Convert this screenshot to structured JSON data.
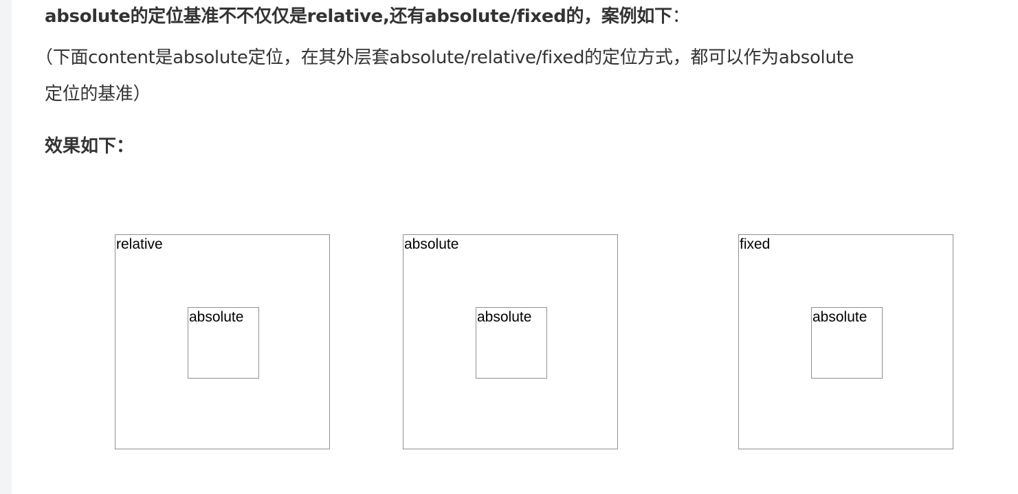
{
  "article": {
    "heading": "absolute的定位基准不不仅仅是relative,还有absolute/fixed的，案例如下",
    "heading_colon": "：",
    "paragraph_line1": "（下面content是absolute定位，在其外层套absolute/relative/fixed的定位方式，都可以作为absolute",
    "paragraph_line2": "定位的基准）",
    "effect_title": "效果如下："
  },
  "demos": [
    {
      "outer_label": "relative",
      "inner_label": "absolute"
    },
    {
      "outer_label": "absolute",
      "inner_label": "absolute"
    },
    {
      "outer_label": "fixed",
      "inner_label": "absolute"
    }
  ],
  "colors": {
    "text": "#333333",
    "box_border": "#8f8f8f",
    "rail": "#f3f4f6"
  }
}
